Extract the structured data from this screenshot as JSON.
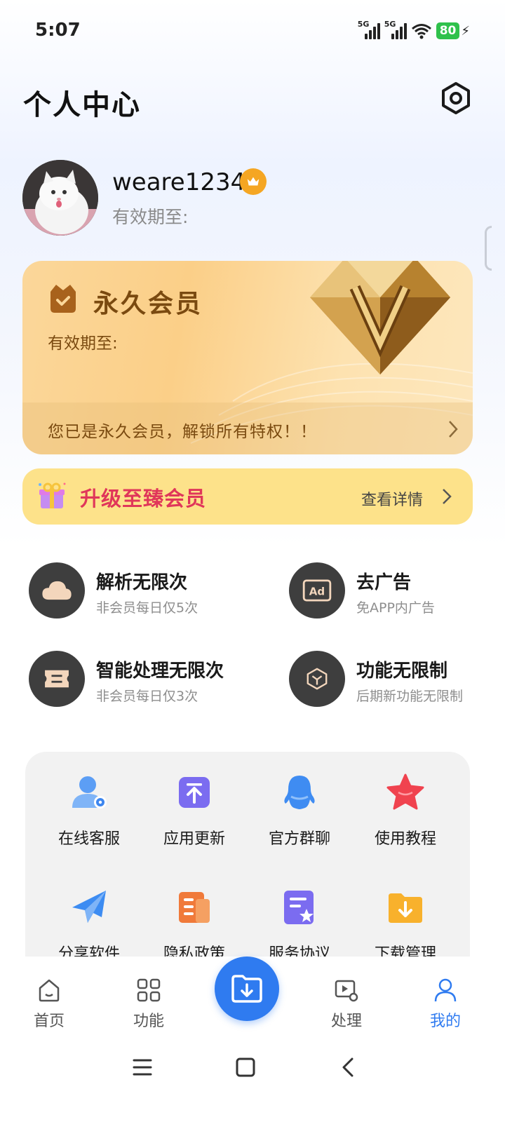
{
  "status_bar": {
    "time": "5:07",
    "network_1": "5G",
    "network_2": "5G",
    "battery": "80"
  },
  "header": {
    "title": "个人中心"
  },
  "profile": {
    "username": "weare1234",
    "expiry_label": "有效期至:"
  },
  "vip_card": {
    "title": "永久会员",
    "expiry_label": "有效期至:",
    "footer_text": "您已是永久会员，解锁所有特权！！"
  },
  "upgrade": {
    "title": "升级至臻会员",
    "detail_label": "查看详情"
  },
  "perks": [
    {
      "title": "解析无限次",
      "subtitle": "非会员每日仅5次",
      "icon": "cloud-icon"
    },
    {
      "title": "去广告",
      "subtitle": "免APP内广告",
      "icon": "ad-icon"
    },
    {
      "title": "智能处理无限次",
      "subtitle": "非会员每日仅3次",
      "icon": "ticket-icon"
    },
    {
      "title": "功能无限制",
      "subtitle": "后期新功能无限制",
      "icon": "cube-icon"
    }
  ],
  "tools": [
    {
      "label": "在线客服",
      "icon": "customer-service-icon"
    },
    {
      "label": "应用更新",
      "icon": "app-update-icon"
    },
    {
      "label": "官方群聊",
      "icon": "qq-penguin-icon"
    },
    {
      "label": "使用教程",
      "icon": "star-icon"
    },
    {
      "label": "分享软件",
      "icon": "paper-plane-icon"
    },
    {
      "label": "隐私政策",
      "icon": "document-icon"
    },
    {
      "label": "服务协议",
      "icon": "agreement-icon"
    },
    {
      "label": "下载管理",
      "icon": "download-folder-icon"
    }
  ],
  "bottom_nav": {
    "home": "首页",
    "features": "功能",
    "process": "处理",
    "mine": "我的",
    "active": "mine"
  },
  "colors": {
    "accent_blue": "#2f7bf0",
    "vip_gold": "#7a4a10",
    "upgrade_pink": "#e0365a",
    "upgrade_bg": "#fde28a",
    "crown_orange": "#f5a623",
    "battery_green": "#2fc14c"
  }
}
